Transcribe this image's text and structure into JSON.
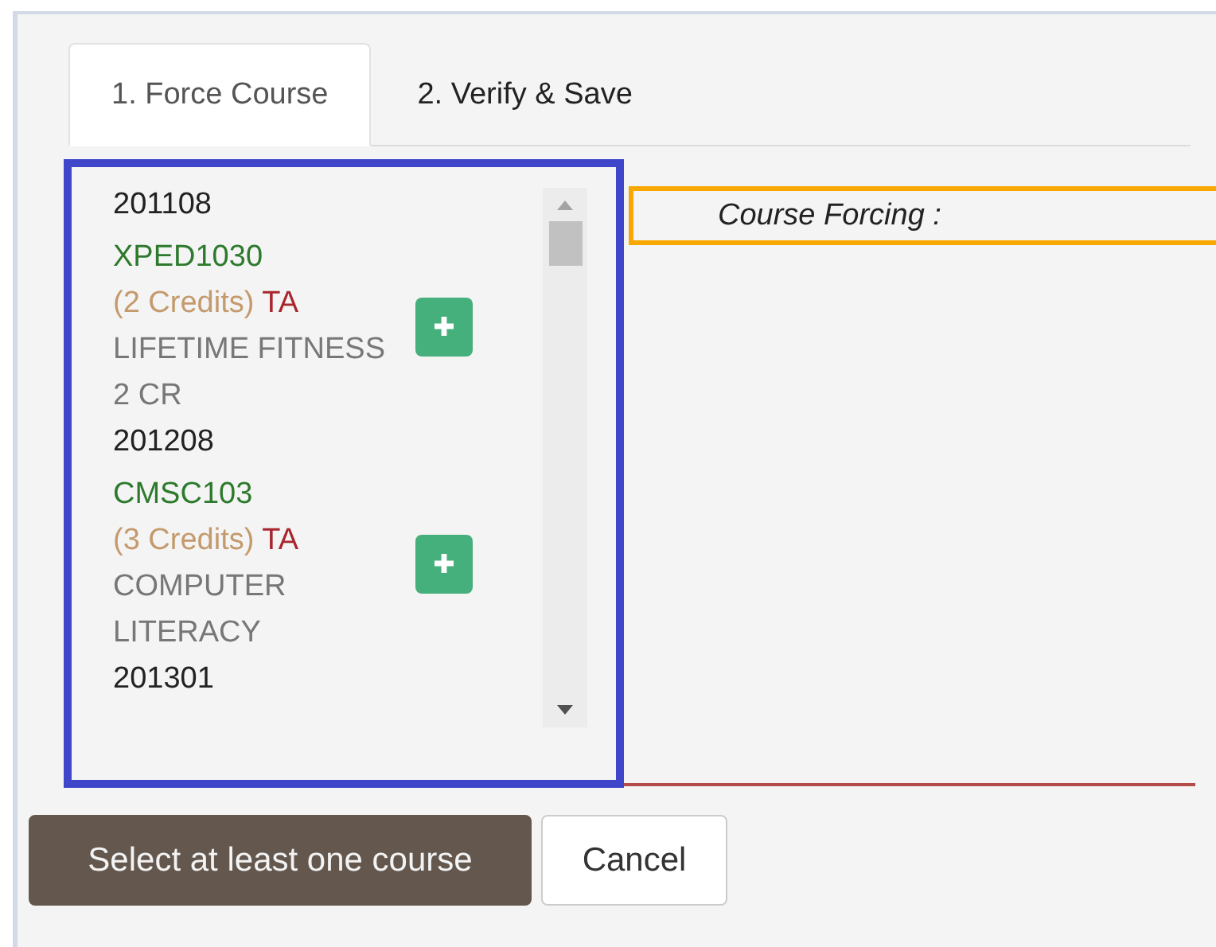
{
  "tabs": [
    {
      "label": "1. Force Course",
      "selected": true
    },
    {
      "label": "2. Verify & Save",
      "selected": false
    }
  ],
  "course_list": {
    "terms": [
      {
        "term": "201108",
        "courses": [
          {
            "code": "XPED1030",
            "credits": "(2 Credits)",
            "attribute": "TA",
            "title": "LIFETIME FITNESS 2 CR"
          }
        ]
      },
      {
        "term": "201208",
        "courses": [
          {
            "code": "CMSC103",
            "credits": "(3 Credits)",
            "attribute": "TA",
            "title": "COMPUTER LITERACY"
          }
        ]
      },
      {
        "term": "201301"
      }
    ]
  },
  "course_forcing": {
    "label": "Course Forcing :"
  },
  "buttons": [
    {
      "label": "Select at least one course",
      "kind": "primary"
    },
    {
      "label": "Cancel",
      "kind": "secondary"
    }
  ]
}
